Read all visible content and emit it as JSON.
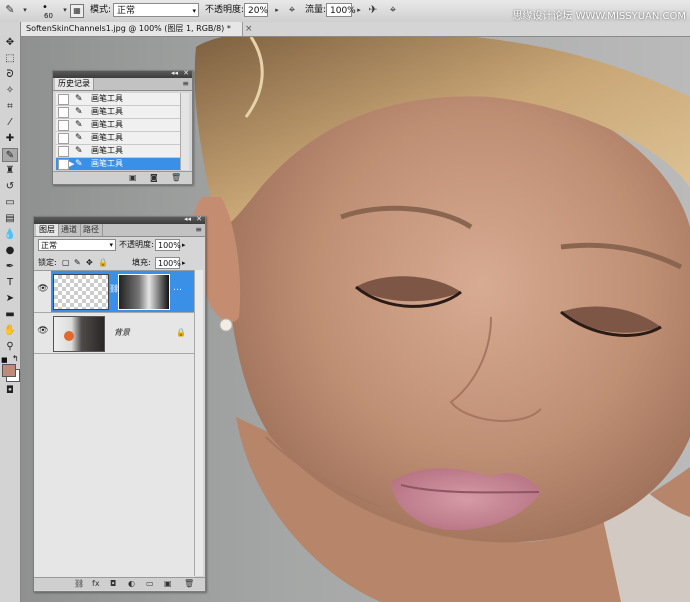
{
  "options_bar": {
    "brush_size": "60",
    "mode_label": "模式:",
    "mode_value": "正常",
    "opacity_label": "不透明度:",
    "opacity_value": "20%",
    "flow_label": "流量:",
    "flow_value": "100%",
    "watermark": "思缘设计论坛 WWW.MISSYUAN.COM"
  },
  "document": {
    "tab_title": "SoftenSkinChannels1.jpg @ 100% (图层 1, RGB/8) *",
    "close": "×"
  },
  "history_panel": {
    "tab": "历史记录",
    "items": [
      "画笔工具",
      "画笔工具",
      "画笔工具",
      "画笔工具",
      "画笔工具",
      "画笔工具"
    ],
    "current_index": 5
  },
  "layers_panel": {
    "tabs": [
      "图层",
      "通道",
      "路径"
    ],
    "blend_mode": "正常",
    "opacity_label": "不透明度:",
    "opacity_value": "100%",
    "lock_label": "锁定:",
    "fill_label": "填充:",
    "fill_value": "100%",
    "layers": [
      {
        "name": "",
        "selected": true,
        "visible": true,
        "has_mask": true
      },
      {
        "name": "背景",
        "selected": false,
        "visible": true,
        "locked": true
      }
    ]
  },
  "colors": {
    "foreground": "#c08a78",
    "background": "#ffffff",
    "selection": "#3a8fe6"
  }
}
